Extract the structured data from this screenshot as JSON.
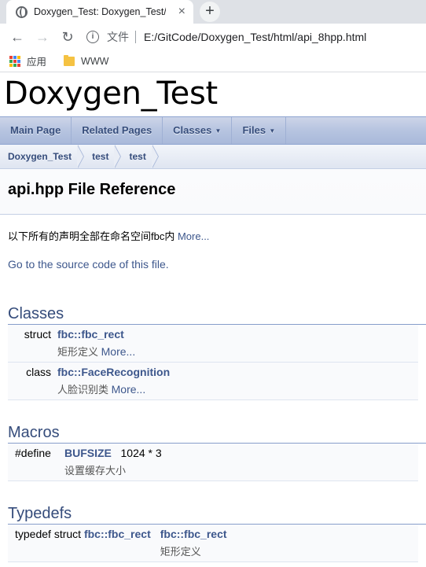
{
  "browser": {
    "tab_title": "Doxygen_Test: Doxygen_Test/t",
    "tab_close": "×",
    "new_tab": "+",
    "security_label": "文件",
    "url": "E:/GitCode/Doxygen_Test/html/api_8hpp.html",
    "bookmarks": [
      {
        "label": "应用",
        "icon": "apps-grid-icon"
      },
      {
        "label": "WWW",
        "icon": "folder-icon"
      }
    ]
  },
  "page": {
    "project_name": "Doxygen_Test",
    "nav_tabs": [
      {
        "label": "Main Page",
        "dropdown": false
      },
      {
        "label": "Related Pages",
        "dropdown": false
      },
      {
        "label": "Classes",
        "dropdown": true
      },
      {
        "label": "Files",
        "dropdown": true
      }
    ],
    "breadcrumbs": [
      "Doxygen_Test",
      "test",
      "test"
    ],
    "title": "api.hpp File Reference",
    "brief": "以下所有的声明全部在命名空间fbc内",
    "more": "More...",
    "source_link": "Go to the source code of this file.",
    "sections": {
      "classes": {
        "heading": "Classes",
        "items": [
          {
            "kind": "struct",
            "name": "fbc::fbc_rect",
            "desc": "矩形定义",
            "more": "More..."
          },
          {
            "kind": "class",
            "name": "fbc::FaceRecognition",
            "desc": "人脸识别类",
            "more": "More..."
          }
        ]
      },
      "macros": {
        "heading": "Macros",
        "items": [
          {
            "kind": "#define",
            "name": "BUFSIZE",
            "value": "1024 * 3",
            "desc": "设置缓存大小"
          }
        ]
      },
      "typedefs": {
        "heading": "Typedefs",
        "items": [
          {
            "kind": "typedef struct",
            "type": "fbc::fbc_rect",
            "name": "fbc::fbc_rect",
            "desc": "矩形定义"
          }
        ]
      }
    }
  },
  "colors": {
    "link": "#3d578c",
    "group_header": "#354c7b",
    "nav_text": "#364d7c"
  }
}
